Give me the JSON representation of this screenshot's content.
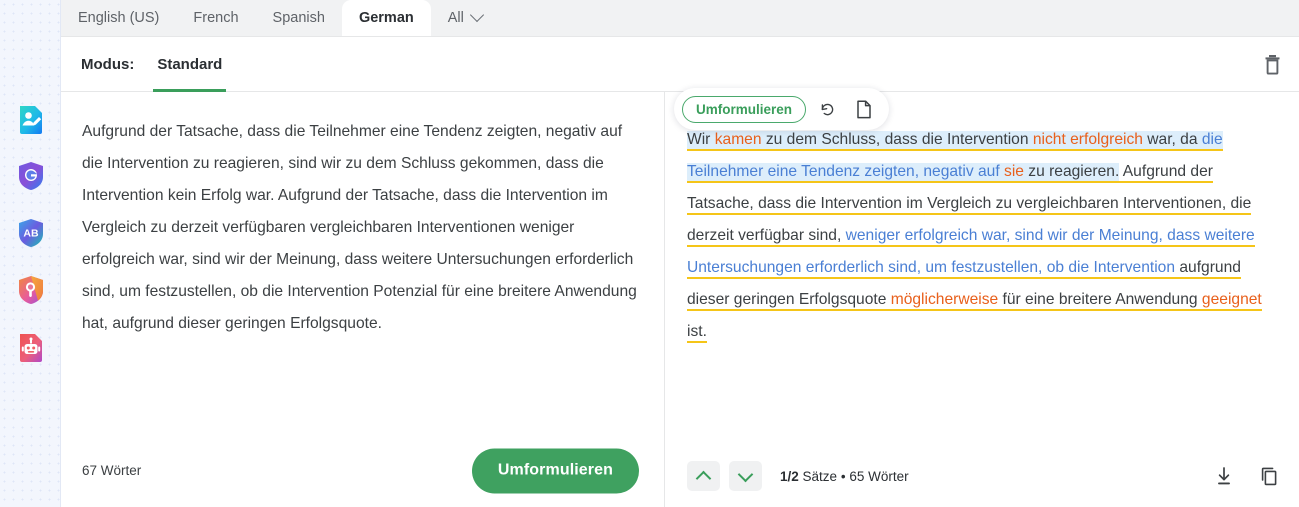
{
  "sidebar": {
    "items": [
      {
        "name": "grammar-checker-icon",
        "label": "Grammar Checker"
      },
      {
        "name": "plagiarism-shield-icon",
        "label": "Plagiarism Checker"
      },
      {
        "name": "ab-shield-icon",
        "label": "AB Detector"
      },
      {
        "name": "search-shield-icon",
        "label": "AI Content Detector"
      },
      {
        "name": "robot-document-icon",
        "label": "AI Writer"
      }
    ]
  },
  "tabs": {
    "items": [
      {
        "label": "English (US)",
        "active": false
      },
      {
        "label": "French",
        "active": false
      },
      {
        "label": "Spanish",
        "active": false
      },
      {
        "label": "German",
        "active": true
      }
    ],
    "all_label": "All"
  },
  "modus": {
    "label": "Modus:",
    "value": "Standard"
  },
  "toolbar": {
    "trash_icon": "trash-icon"
  },
  "left_panel": {
    "source_text": "Aufgrund der Tatsache, dass die Teilnehmer eine Tendenz zeigten, negativ auf die Intervention zu reagieren, sind wir zu dem Schluss gekommen, dass die Intervention kein Erfolg war. Aufgrund der Tatsache, dass die Intervention im Vergleich zu derzeit verfügbaren vergleichbaren Interventionen weniger erfolgreich war, sind wir der Meinung, dass weitere Untersuchungen erforderlich sind, um festzustellen, ob die Intervention Potenzial für eine breitere Anwendung hat, aufgrund dieser geringen Erfolgsquote.",
    "word_count": "67 Wörter",
    "action_button": "Umformulieren"
  },
  "right_panel": {
    "pill": {
      "action_label": "Umformulieren",
      "rephrase_icon": "rotate-ccw-icon",
      "copy_doc_icon": "document-icon"
    },
    "output_segments": [
      {
        "text": "Wir ",
        "style": "plain",
        "sentence": 1
      },
      {
        "text": "kamen",
        "style": "orange",
        "sentence": 1
      },
      {
        "text": " zu dem Schluss, dass die Intervention ",
        "style": "plain",
        "sentence": 1
      },
      {
        "text": "nicht erfolgreich",
        "style": "orange",
        "sentence": 1
      },
      {
        "text": " war, da ",
        "style": "plain",
        "sentence": 1
      },
      {
        "text": "die Teilnehmer eine Tendenz zeigten, negativ auf",
        "style": "blue",
        "sentence": 1
      },
      {
        "text": " ",
        "style": "plain",
        "sentence": 1
      },
      {
        "text": "sie",
        "style": "orange",
        "sentence": 1
      },
      {
        "text": " zu reagieren.",
        "style": "plain",
        "sentence": 1
      },
      {
        "text": " Aufgrund der Tatsache, dass die Intervention im Vergleich zu vergleichbaren Interventionen, die derzeit verfügbar sind, ",
        "style": "plain",
        "sentence": 2
      },
      {
        "text": "weniger erfolgreich war, sind wir der Meinung, dass weitere Untersuchungen erforderlich sind, um festzustellen, ob die Intervention",
        "style": "blue",
        "sentence": 2
      },
      {
        "text": " aufgrund dieser geringen Erfolgsquote ",
        "style": "plain",
        "sentence": 2
      },
      {
        "text": "möglicherweise",
        "style": "orange",
        "sentence": 2
      },
      {
        "text": " für eine breitere Anwendung ",
        "style": "plain",
        "sentence": 2
      },
      {
        "text": "geeignet",
        "style": "orange",
        "sentence": 2
      },
      {
        "text": " ist.",
        "style": "plain",
        "sentence": 2
      }
    ],
    "sentence_counter": "1/2",
    "sentence_counter_suffix": " Sätze",
    "separator": "•",
    "word_count": "65 Wörter",
    "prev_icon": "chevron-up-icon",
    "next_icon": "chevron-down-icon",
    "download_icon": "download-icon",
    "copy_icon": "copy-icon"
  },
  "colors": {
    "accent_green": "#3fa160",
    "highlight_blue": "#ddeefb",
    "underline_yellow": "#f5c518",
    "changed_orange": "#e8601c",
    "moved_blue": "#4a7fd4"
  }
}
